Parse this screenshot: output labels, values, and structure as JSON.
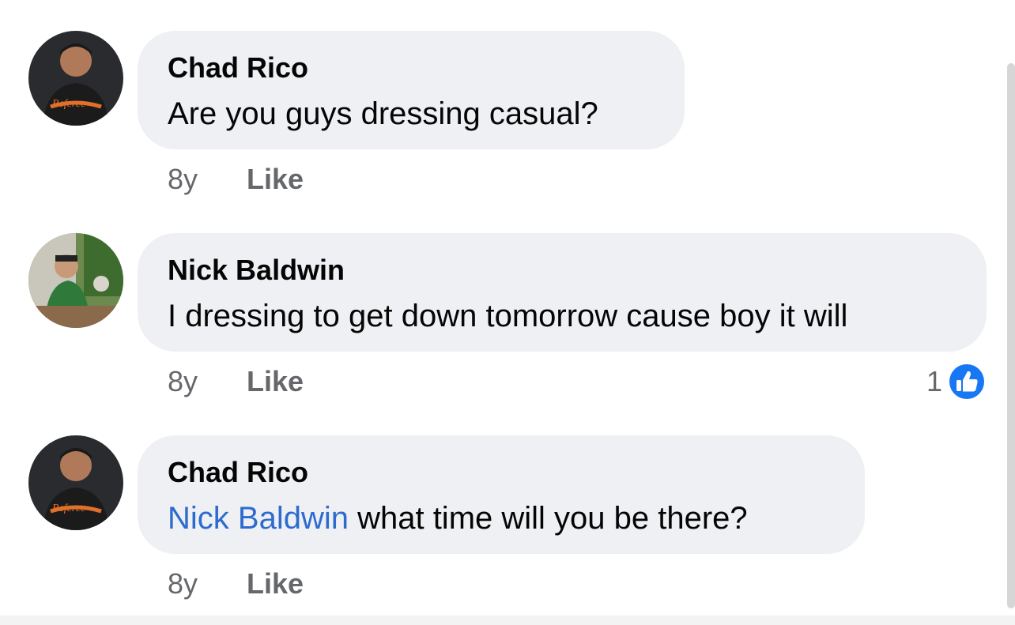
{
  "comments": [
    {
      "author": "Chad Rico",
      "text": "Are you guys dressing casual?",
      "time": "8y",
      "like_label": "Like",
      "avatar": "chad-rico-avatar"
    },
    {
      "author": "Nick Baldwin",
      "text": "I dressing to get down tomorrow cause boy it will",
      "time": "8y",
      "like_label": "Like",
      "reaction_count": "1",
      "reaction_icon": "thumbs-up-icon",
      "avatar": "nick-baldwin-avatar"
    },
    {
      "author": "Chad Rico",
      "mention": "Nick Baldwin",
      "text": " what time will you be there?",
      "time": "8y",
      "like_label": "Like",
      "avatar": "chad-rico-avatar"
    }
  ],
  "colors": {
    "bubble": "#eff0f3",
    "mention": "#2d6bcf",
    "meta": "#65676b",
    "like_badge": "#1877f2"
  }
}
